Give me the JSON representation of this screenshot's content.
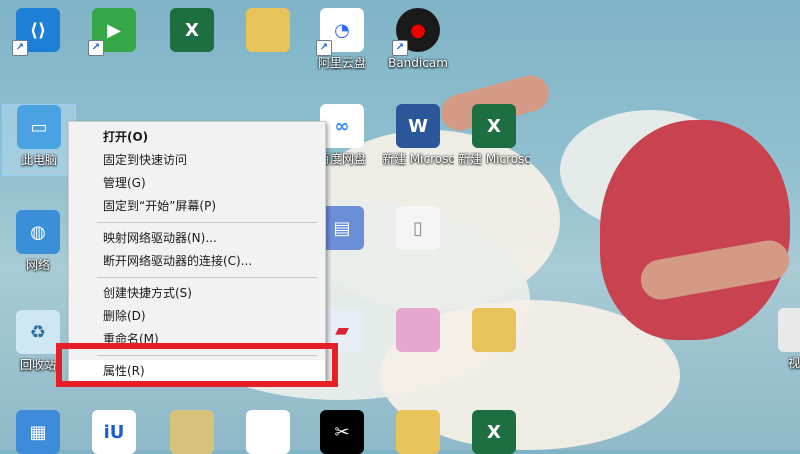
{
  "desktop_icons": [
    {
      "id": "vscode",
      "label": "",
      "glyph": "⟨⟩",
      "color": "#1e7fd6"
    },
    {
      "id": "green-app",
      "label": "",
      "glyph": "▶",
      "color": "#35a746"
    },
    {
      "id": "excel-top",
      "label": "",
      "glyph": "X",
      "color": "#1d6f42"
    },
    {
      "id": "folder-top",
      "label": "",
      "glyph": "",
      "color": "#e8c35a"
    },
    {
      "id": "aliyun",
      "label": "阿里云盘",
      "glyph": "◔",
      "color": "#ffffff"
    },
    {
      "id": "bandicam",
      "label": "Bandicam",
      "glyph": "●",
      "color": "#1a1a1a"
    },
    {
      "id": "this-pc",
      "label": "此电脑",
      "glyph": "▭",
      "color": "#4aa3e0"
    },
    {
      "id": "network",
      "label": "网络",
      "glyph": "◍",
      "color": "#3b8fd8"
    },
    {
      "id": "recycle",
      "label": "回收站",
      "glyph": "♻",
      "color": "#cfe6f3"
    },
    {
      "id": "baidu",
      "label": "百度网盘",
      "glyph": "∞",
      "color": "#ffffff"
    },
    {
      "id": "word-new",
      "label": "新建 Microsoft",
      "glyph": "W",
      "color": "#2b579a"
    },
    {
      "id": "excel-new",
      "label": "新建 Microsoft",
      "glyph": "X",
      "color": "#1d6f42"
    },
    {
      "id": "winrar",
      "label": "",
      "glyph": "▤",
      "color": "#6a8fd8"
    },
    {
      "id": "phone",
      "label": "",
      "glyph": "▯",
      "color": "#f5f5f5"
    },
    {
      "id": "train",
      "label": "",
      "glyph": "▰",
      "color": "#e8eef5"
    },
    {
      "id": "pink-image",
      "label": "",
      "glyph": "",
      "color": "#e6a6cf"
    },
    {
      "id": "folder-mid",
      "label": "",
      "glyph": "",
      "color": "#e8c35a"
    },
    {
      "id": "video",
      "label": "视频",
      "glyph": "",
      "color": "#e9e9e9"
    },
    {
      "id": "control",
      "label": "",
      "glyph": "▦",
      "color": "#3c8ad8"
    },
    {
      "id": "iu",
      "label": "",
      "glyph": "iU",
      "color": "#ffffff"
    },
    {
      "id": "book",
      "label": "",
      "glyph": "",
      "color": "#d8c27a"
    },
    {
      "id": "doc",
      "label": "",
      "glyph": "",
      "color": "#ffffff"
    },
    {
      "id": "capcut",
      "label": "",
      "glyph": "✂",
      "color": "#000000"
    },
    {
      "id": "folder-bottom",
      "label": "",
      "glyph": "",
      "color": "#e8c35a"
    },
    {
      "id": "excel-bottom",
      "label": "",
      "glyph": "X",
      "color": "#1d6f42"
    }
  ],
  "context_menu": {
    "items": [
      {
        "label": "打开(O)",
        "bold": true
      },
      {
        "label": "固定到快速访问"
      },
      {
        "label": "管理(G)"
      },
      {
        "label": "固定到“开始”屏幕(P)"
      },
      {
        "sep": true
      },
      {
        "label": "映射网络驱动器(N)..."
      },
      {
        "label": "断开网络驱动器的连接(C)..."
      },
      {
        "sep": true
      },
      {
        "label": "创建快捷方式(S)"
      },
      {
        "label": "删除(D)"
      },
      {
        "label": "重命名(M)"
      },
      {
        "sep": true
      },
      {
        "label": "属性(R)",
        "highlight": true
      }
    ]
  },
  "highlight_color": "#e41f26"
}
